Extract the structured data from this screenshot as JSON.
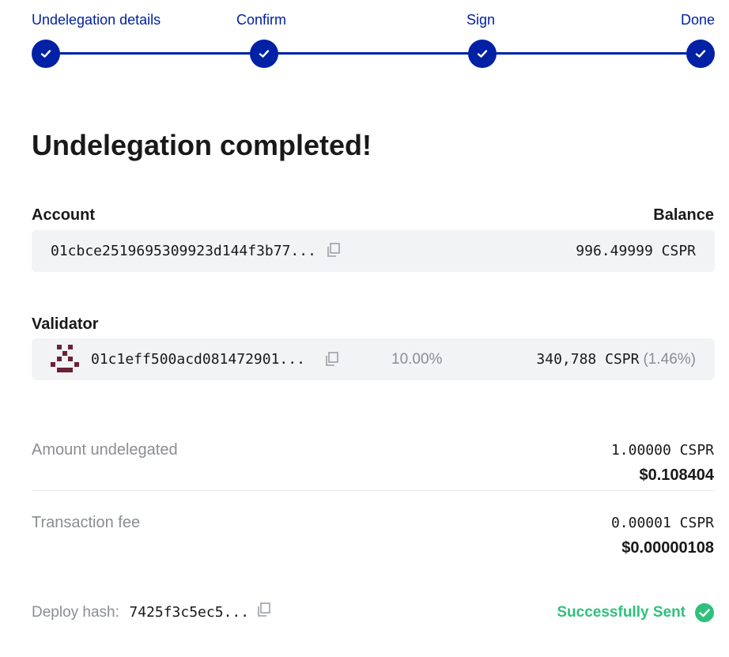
{
  "stepper": {
    "steps": [
      {
        "label": "Undelegation details"
      },
      {
        "label": "Confirm"
      },
      {
        "label": "Sign"
      },
      {
        "label": "Done"
      }
    ],
    "icon": "check-icon",
    "accent_color": "#0021a5"
  },
  "title": "Undelegation completed!",
  "account": {
    "label": "Account",
    "balance_label": "Balance",
    "address": "01cbce2519695309923d144f3b77...",
    "balance": "996.49999 CSPR",
    "copy_icon": "copy-icon"
  },
  "validator": {
    "label": "Validator",
    "avatar_icon": "identicon-avatar",
    "address": "01c1eff500acd081472901...",
    "fee": "10.00%",
    "stake": "340,788 CSPR",
    "share": "(1.46%)",
    "copy_icon": "copy-icon"
  },
  "amount": {
    "label": "Amount undelegated",
    "crypto": "1.00000 CSPR",
    "fiat": "$0.108404"
  },
  "fee": {
    "label": "Transaction fee",
    "crypto": "0.00001 CSPR",
    "fiat": "$0.00000108"
  },
  "deploy": {
    "label": "Deploy hash:",
    "hash": "7425f3c5ec5...",
    "status": "Successfully Sent",
    "status_color": "#2ec17b",
    "status_icon": "check-circle-icon"
  }
}
